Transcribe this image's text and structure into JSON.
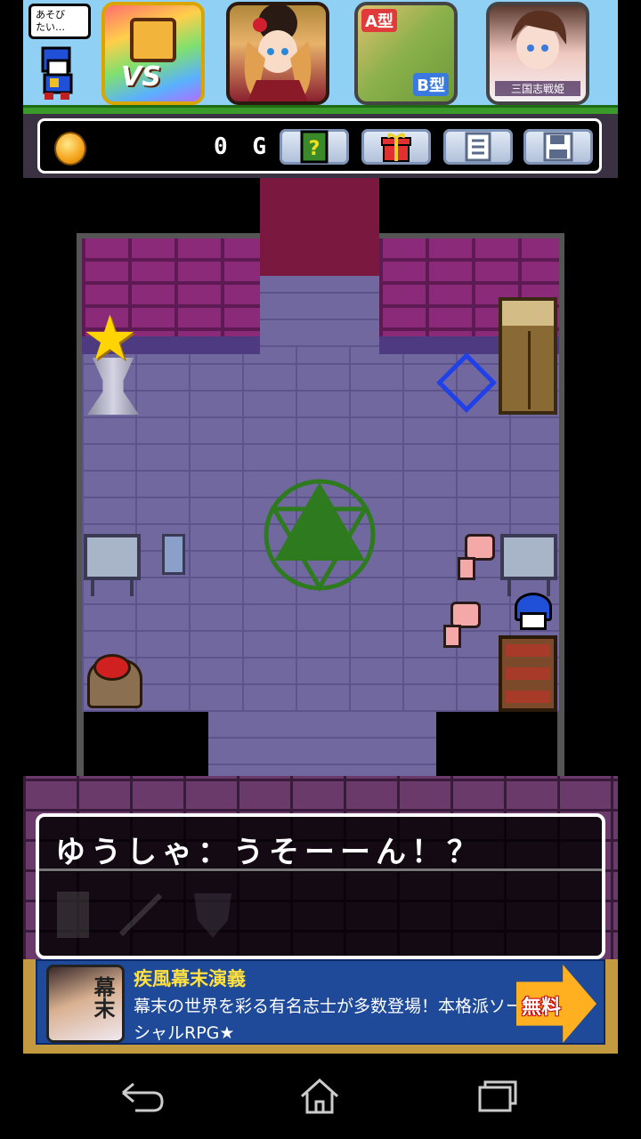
{
  "top_ads": {
    "asobi_label": "あそび\nたい…",
    "tiles": [
      {
        "id": "vs",
        "text": "VS"
      },
      {
        "id": "girl1",
        "text": ""
      },
      {
        "id": "farm",
        "tag_a": "A型",
        "tag_b": "B型"
      },
      {
        "id": "girl2",
        "caption": "三国志戦姫"
      }
    ]
  },
  "status": {
    "gold_value": "0",
    "gold_unit": "G",
    "buttons": [
      {
        "name": "help-book",
        "icon": "?"
      },
      {
        "name": "gift",
        "icon": "🎁"
      },
      {
        "name": "list",
        "icon": "☰"
      },
      {
        "name": "save",
        "icon": "💾"
      }
    ]
  },
  "dialog": {
    "text": "ゆうしゃ：うそーーん！？"
  },
  "bottom_ad": {
    "title": "疾風幕末演義",
    "description": "幕末の世界を彩る有名志士が多数登場！本格派ソーシャルRPG★",
    "thumb_text": "幕末",
    "button_label": "無料"
  },
  "navbar": {
    "back_icon": "back-icon",
    "home_icon": "home-icon",
    "recent_icon": "recent-apps-icon"
  },
  "colors": {
    "floor": "#7268a0",
    "wall": "#8a2a78",
    "magic_circle": "#2e7a1e",
    "diamond": "#2040e8",
    "ad_bg": "#1f4a9a"
  }
}
